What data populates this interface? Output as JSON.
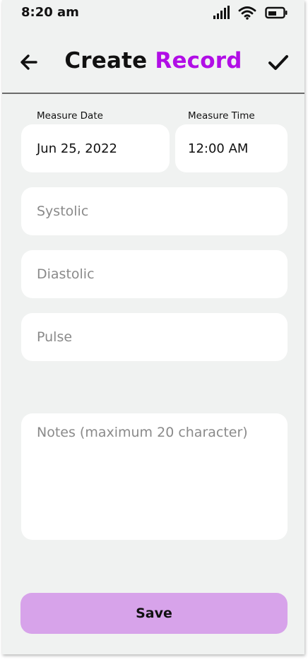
{
  "status_bar": {
    "time": "8:20 am",
    "icons": [
      "signal-icon",
      "wifi-icon",
      "battery-icon"
    ]
  },
  "header": {
    "title_part1": "Create ",
    "title_part2": "Record",
    "back_icon": "arrow-left-icon",
    "confirm_icon": "checkmark-icon"
  },
  "form": {
    "measure_date": {
      "label": "Measure Date",
      "value": "Jun 25, 2022"
    },
    "measure_time": {
      "label": "Measure Time",
      "value": "12:00 AM"
    },
    "systolic": {
      "placeholder": "Systolic"
    },
    "diastolic": {
      "placeholder": "Diastolic"
    },
    "pulse": {
      "placeholder": "Pulse"
    },
    "notes": {
      "placeholder": "Notes (maximum 20 character)"
    }
  },
  "save_button": {
    "label": "Save"
  },
  "colors": {
    "accent": "#b10ee6",
    "save_button_bg": "#d7a3ea",
    "background": "#f0f2f1",
    "field_bg": "#ffffff"
  }
}
